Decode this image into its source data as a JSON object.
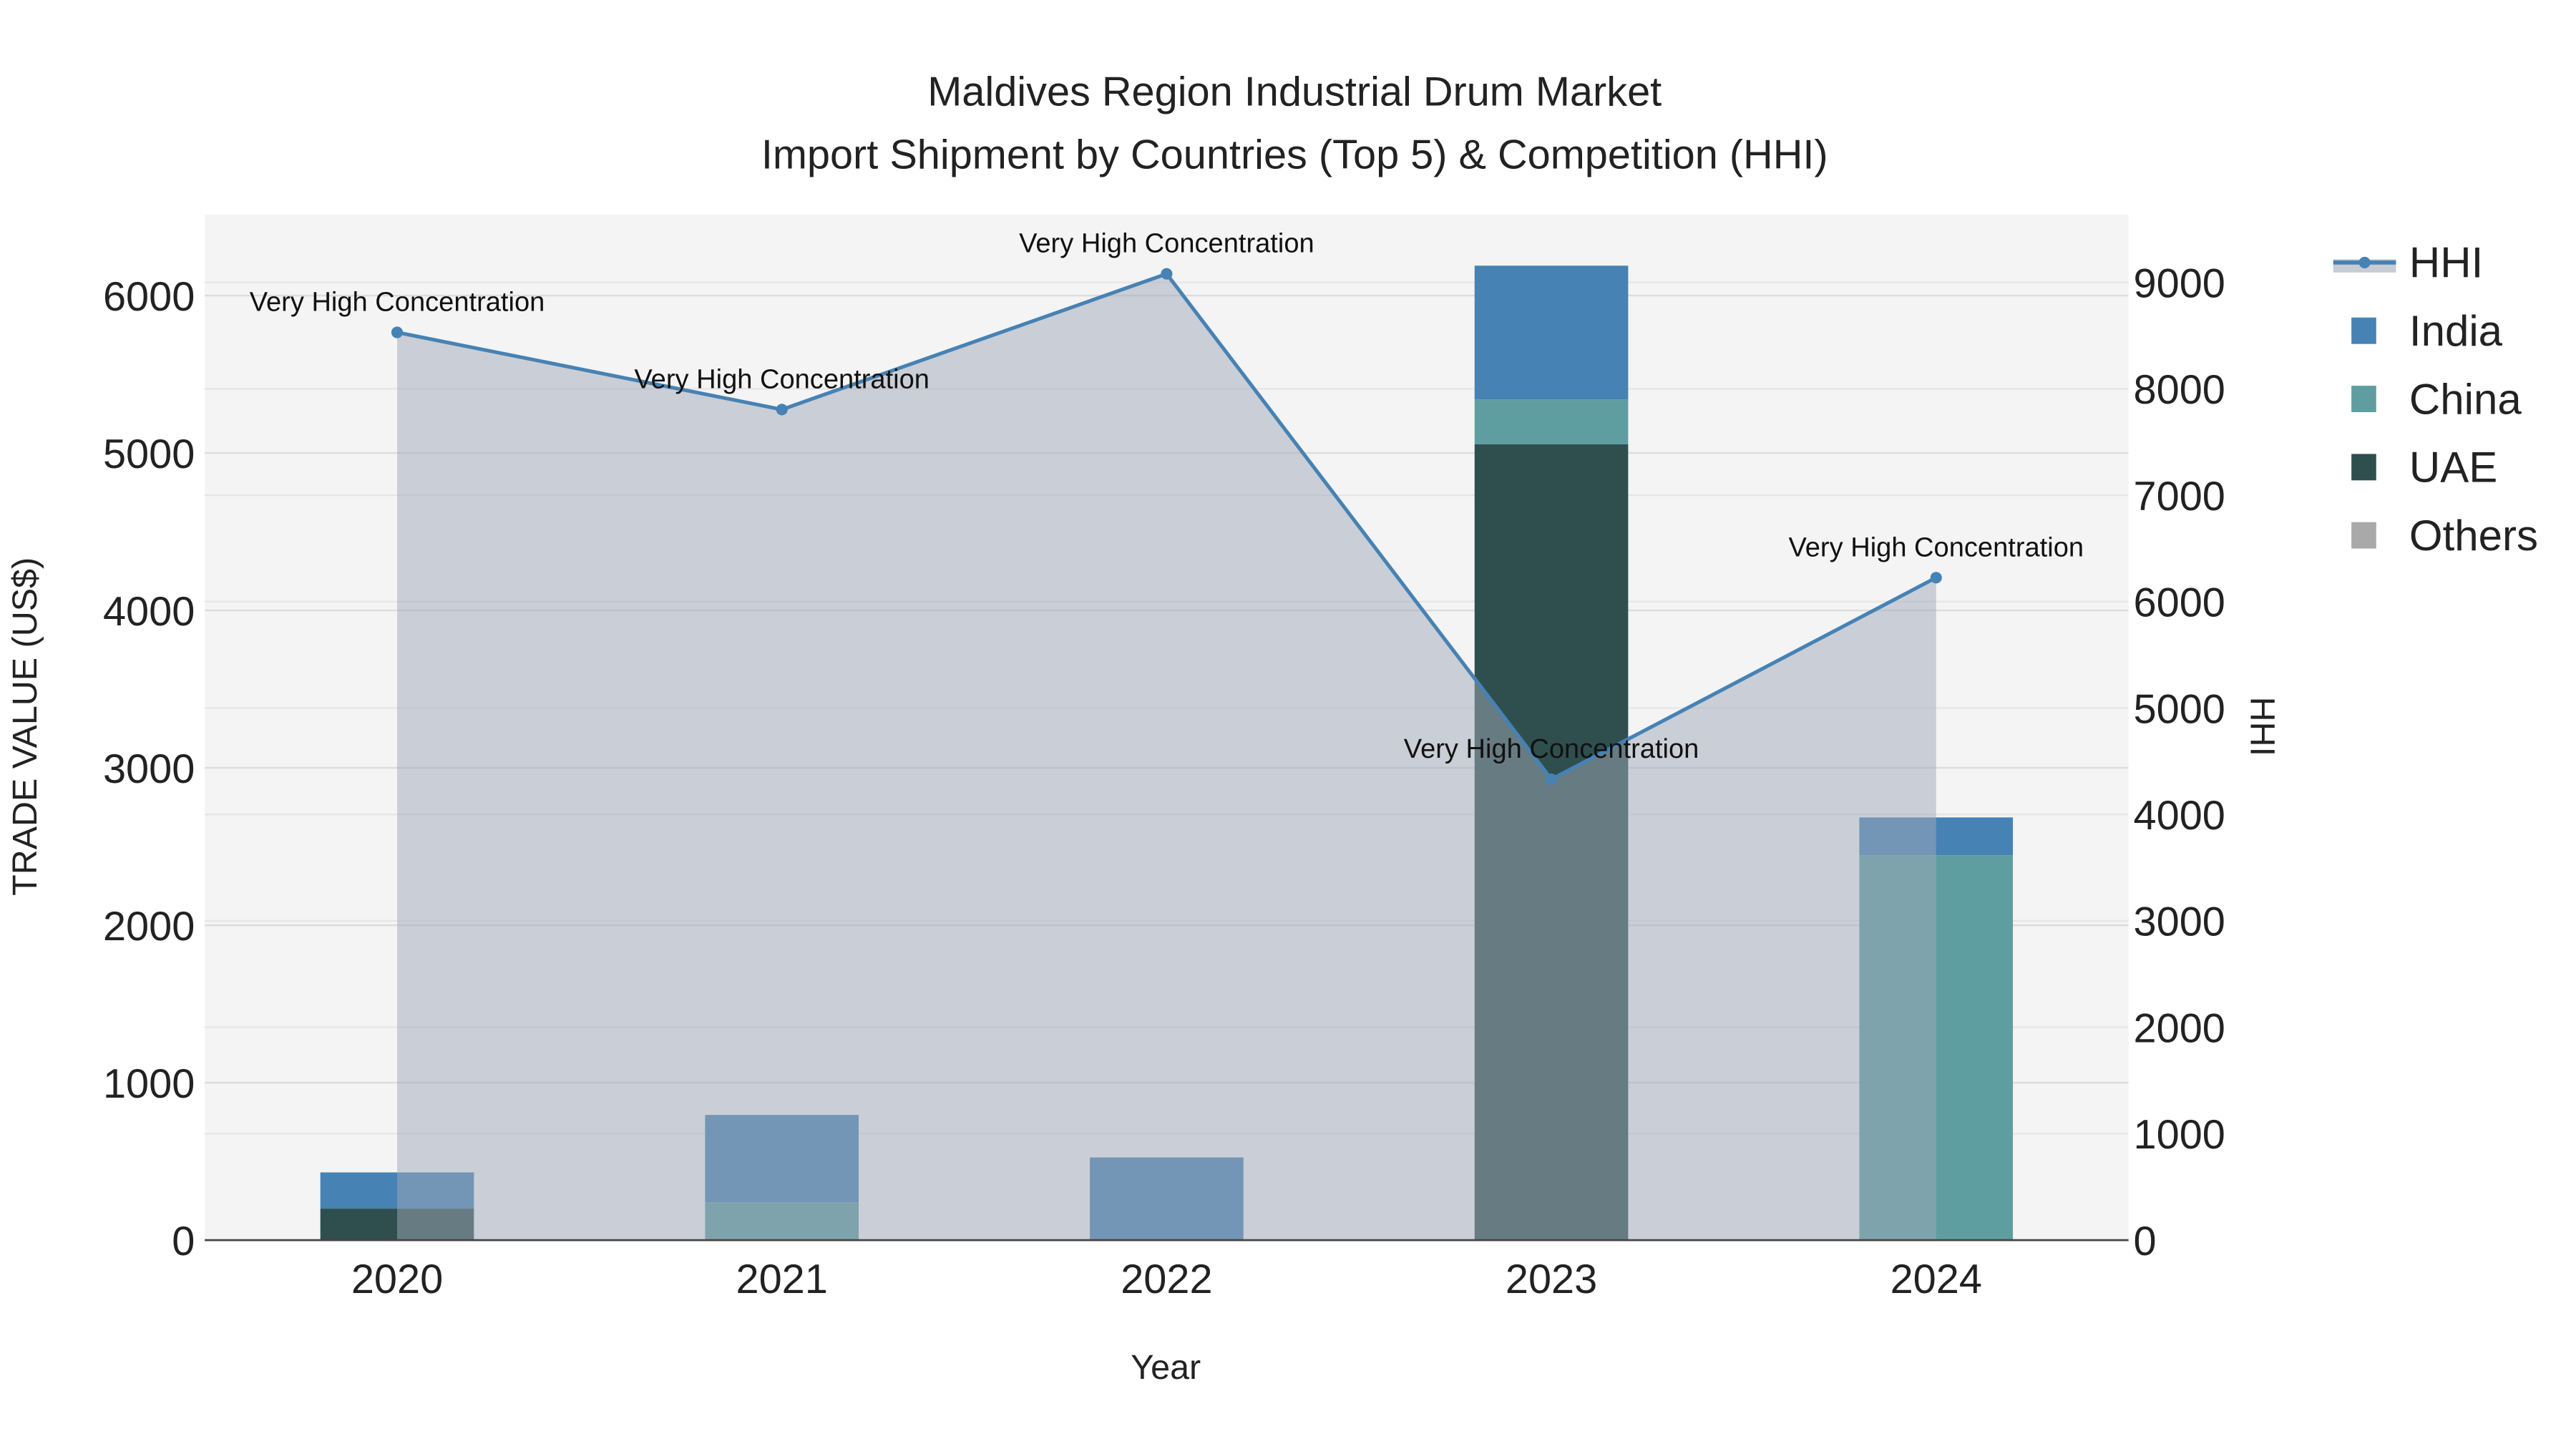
{
  "chart_data": {
    "type": "bar",
    "title_line1": "Maldives Region Industrial Drum Market",
    "title_line2": "Import Shipment by Countries (Top 5) & Competition (HHI)",
    "xlabel": "Year",
    "ylabel": "TRADE VALUE (US$)",
    "y2label": "HHI",
    "categories": [
      "2020",
      "2021",
      "2022",
      "2023",
      "2024"
    ],
    "ylim": [
      0,
      6500
    ],
    "y2lim": [
      0,
      9650
    ],
    "yticks": [
      0,
      1000,
      2000,
      3000,
      4000,
      5000,
      6000
    ],
    "y2ticks": [
      0,
      1000,
      2000,
      3000,
      4000,
      5000,
      6000,
      7000,
      8000,
      9000
    ],
    "grid": true,
    "barmode": "stack",
    "series": [
      {
        "name": "UAE",
        "color": "#2f4f4f",
        "values": [
          200,
          0,
          0,
          5055,
          0
        ]
      },
      {
        "name": "China",
        "color": "#5f9ea0",
        "values": [
          0,
          240,
          0,
          285,
          2445
        ]
      },
      {
        "name": "India",
        "color": "#4682b4",
        "values": [
          230,
          555,
          525,
          850,
          240
        ]
      },
      {
        "name": "Others",
        "color": "#a9a9a9",
        "values": [
          0,
          0,
          0,
          0,
          0
        ]
      }
    ],
    "hhi": {
      "name": "HHI",
      "color": "#4682b4",
      "values": [
        8530,
        7805,
        9080,
        4330,
        6225
      ],
      "labels": [
        "Very High Concentration",
        "Very High Concentration",
        "Very High Concentration",
        "Very High Concentration",
        "Very High Concentration"
      ]
    },
    "legend": [
      "HHI",
      "India",
      "China",
      "UAE",
      "Others"
    ],
    "legend_position": "right"
  }
}
